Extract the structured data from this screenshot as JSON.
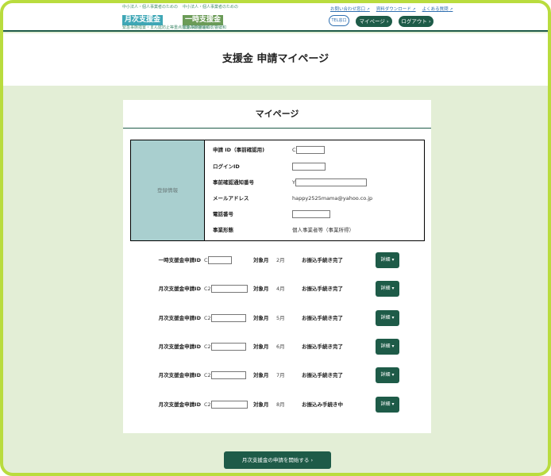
{
  "header": {
    "logo_monthly": {
      "caption": "中小法人・個人事業者のための",
      "name": "月次支援金",
      "sub": "緊急事態措置・まん延防止等重点措置の影響緩和"
    },
    "logo_temporary": {
      "caption": "中小法人・個人事業者のための",
      "name": "一時支援金",
      "sub": "緊急事態宣言の影響緩和"
    },
    "links": [
      "お問い合わせ窓口",
      "資料ダウンロード",
      "よくある質問"
    ],
    "phone_badge": "TEL窓口",
    "mypage_label": "マイページ ›",
    "logout_label": "ログアウト ›"
  },
  "page_title": "支援金 申請マイページ",
  "card_title": "マイページ",
  "registration": {
    "side_label": "登録情報",
    "rows": [
      {
        "label": "申請 ID（事前確認用)",
        "value": "C"
      },
      {
        "label": "ログインID",
        "value": ""
      },
      {
        "label": "事前確認通知番号",
        "value": "Y"
      },
      {
        "label": "メールアドレス",
        "value": "happy2525mama@yahoo.co.jp"
      },
      {
        "label": "電話番号",
        "value": ""
      },
      {
        "label": "事業形態",
        "value": "個人事業者等（事業所得）"
      }
    ]
  },
  "applications": [
    {
      "label": "一時支援金申請ID",
      "id_prefix": "C",
      "month_label": "対象月",
      "month": "2月",
      "status": "お振込手続き完了",
      "details": "詳細 ▾"
    },
    {
      "label": "月次支援金申請ID",
      "id_prefix": "C2",
      "month_label": "対象月",
      "month": "4月",
      "status": "お振込手続き完了",
      "details": "詳細 ▾"
    },
    {
      "label": "月次支援金申請ID",
      "id_prefix": "C2",
      "month_label": "対象月",
      "month": "5月",
      "status": "お振込手続き完了",
      "details": "詳細 ▾"
    },
    {
      "label": "月次支援金申請ID",
      "id_prefix": "C2",
      "month_label": "対象月",
      "month": "6月",
      "status": "お振込手続き完了",
      "details": "詳細 ▾"
    },
    {
      "label": "月次支援金申請ID",
      "id_prefix": "C2",
      "month_label": "対象月",
      "month": "7月",
      "status": "お振込手続き完了",
      "details": "詳細 ▾"
    },
    {
      "label": "月次支援金申請ID",
      "id_prefix": "C2",
      "month_label": "対象月",
      "month": "8月",
      "status": "お振込み手続き中",
      "details": "詳細 ▾"
    }
  ],
  "start_button": "月次支援金の申請を開始する ›"
}
